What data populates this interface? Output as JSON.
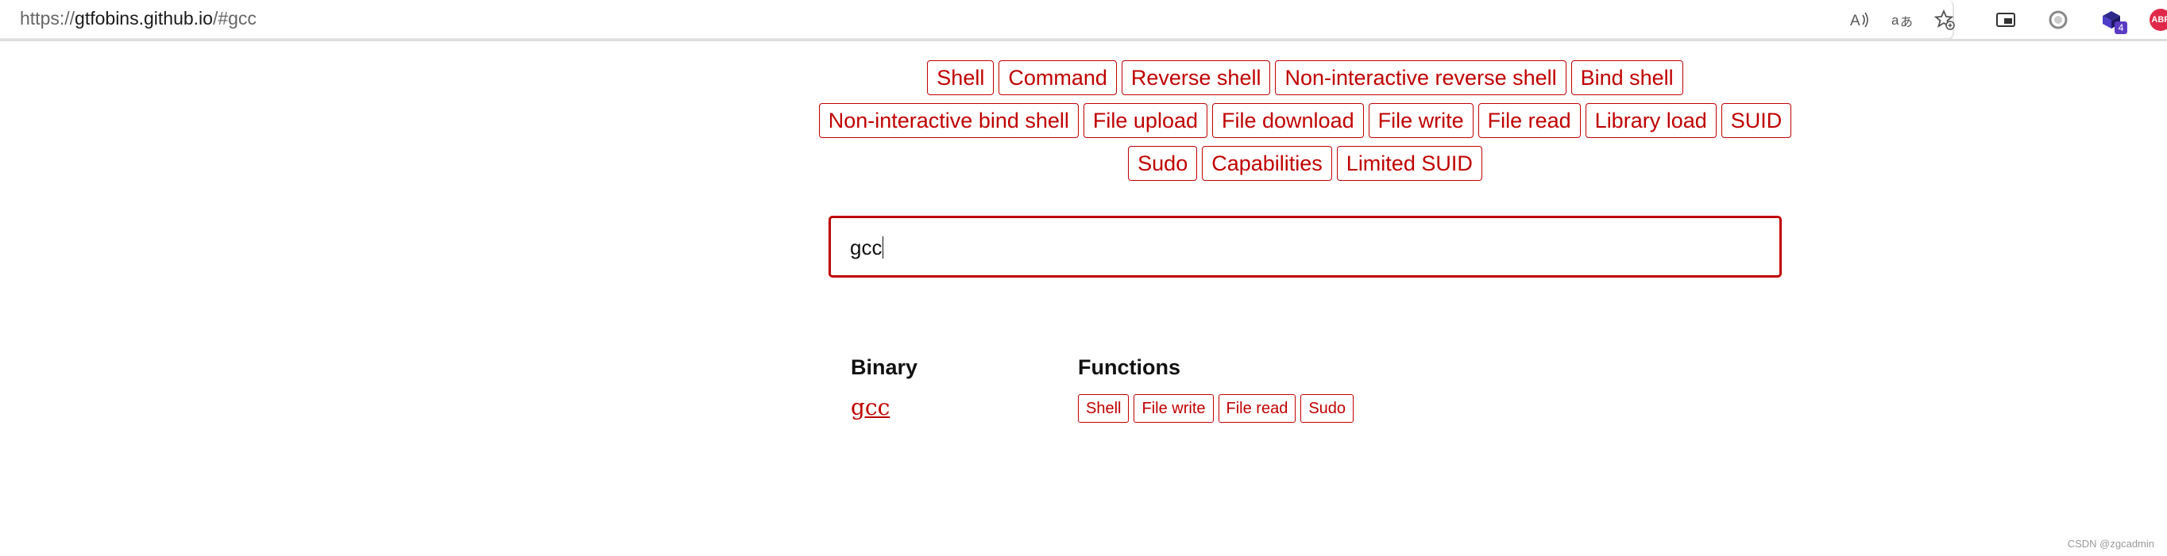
{
  "browser": {
    "url_scheme": "https://",
    "url_host": "gtfobins.github.io",
    "url_path": "/#gcc",
    "extension_badge": "4",
    "abp_label": "ABP"
  },
  "filters": {
    "row1": [
      "Shell",
      "Command",
      "Reverse shell",
      "Non-interactive reverse shell",
      "Bind shell"
    ],
    "row2": [
      "Non-interactive bind shell",
      "File upload",
      "File download",
      "File write",
      "File read",
      "Library load",
      "SUID"
    ],
    "row3": [
      "Sudo",
      "Capabilities",
      "Limited SUID"
    ]
  },
  "search": {
    "value": "gcc"
  },
  "results": {
    "binary_header": "Binary",
    "functions_header": "Functions",
    "binary": "gcc",
    "functions": [
      "Shell",
      "File write",
      "File read",
      "Sudo"
    ]
  },
  "watermark": "CSDN @zgcadmin",
  "colors": {
    "accent": "#c00000"
  }
}
